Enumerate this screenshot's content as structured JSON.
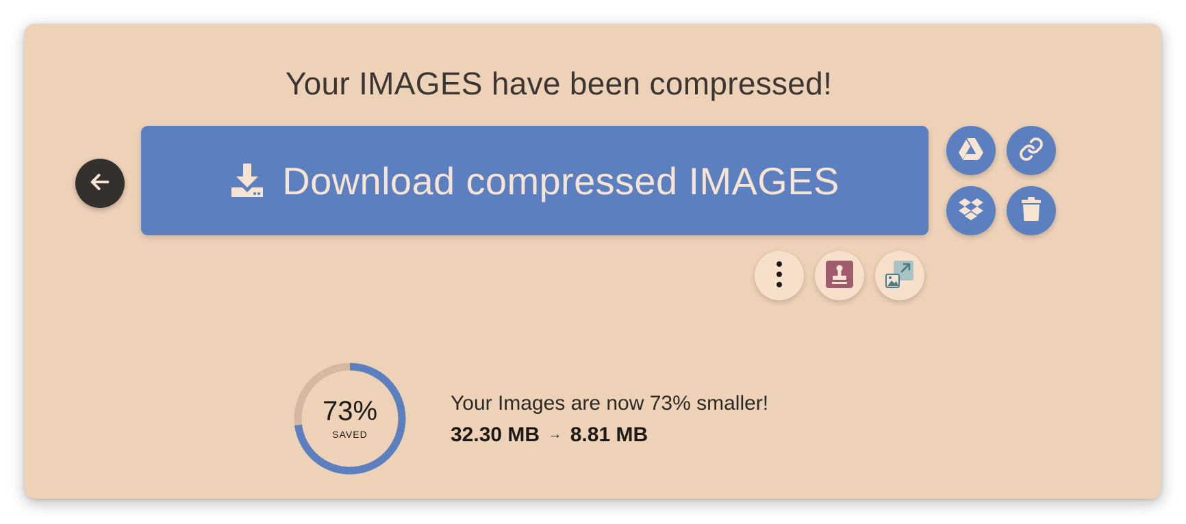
{
  "title": "Your IMAGES have been compressed!",
  "download_label": "Download compressed IMAGES",
  "icons": {
    "back": "arrow-left-icon",
    "download": "download-icon",
    "google_drive": "google-drive-icon",
    "link": "link-icon",
    "dropbox": "dropbox-icon",
    "delete": "trash-icon",
    "more": "more-vertical-icon",
    "watermark": "stamp-icon",
    "resize": "resize-image-icon"
  },
  "colors": {
    "accent": "#5b7fbf",
    "background": "#eed2b8",
    "dark": "#34302d",
    "ring_track": "#d6b8a2",
    "stamp": "#a05c6e",
    "resize": "#4a7d8c"
  },
  "stats": {
    "saved_percent": 73,
    "percent_text": "73%",
    "saved_label": "SAVED",
    "message": "Your Images are now 73% smaller!",
    "original_size": "32.30 MB",
    "arrow": "→",
    "compressed_size": "8.81 MB"
  }
}
